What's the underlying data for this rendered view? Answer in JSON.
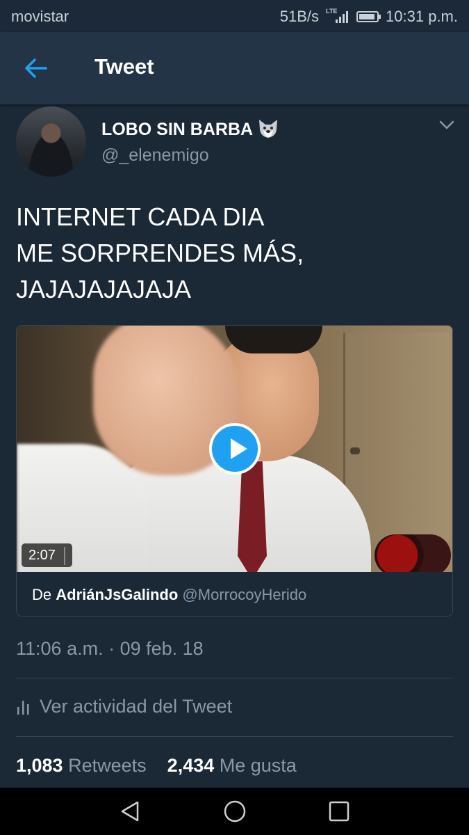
{
  "status_bar": {
    "carrier": "movistar",
    "speed": "51B/s",
    "network": "LTE",
    "time": "10:31 p.m."
  },
  "app_bar": {
    "back_icon": "arrow-left-icon",
    "title": "Tweet"
  },
  "tweet": {
    "author": {
      "name": "LOBO SIN BARBA",
      "emoji_icon": "wolf-face-icon",
      "handle": "@_elenemigo"
    },
    "text_lines": [
      "INTERNET CADA DIA",
      "ME SORPRENDES MÁS,",
      "JAJAJAJAJAJA"
    ],
    "media": {
      "duration": "2:07",
      "attribution_prefix": "De",
      "attribution_name": "AdriánJsGalindo",
      "attribution_handle": "@MorrocoyHerido"
    },
    "timestamp": "11:06 a.m. · 09 feb. 18",
    "activity_label": "Ver actividad del Tweet",
    "retweets_count": "1,083",
    "retweets_label": "Retweets",
    "likes_count": "2,434",
    "likes_label": "Me gusta"
  },
  "colors": {
    "background": "#1b2836",
    "app_bar": "#243447",
    "accent": "#1da1f2",
    "secondary_text": "#8899a6",
    "divider": "#38444d"
  }
}
